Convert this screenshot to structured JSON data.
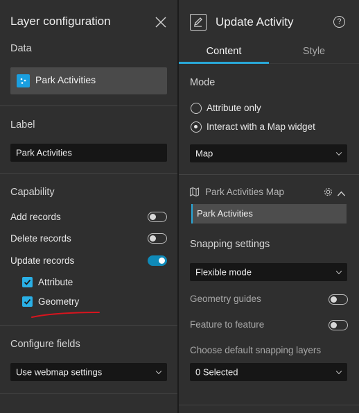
{
  "left_panel": {
    "title": "Layer configuration",
    "data_section": {
      "heading": "Data",
      "layer_name": "Park Activities"
    },
    "label_section": {
      "heading": "Label",
      "value": "Park Activities"
    },
    "capability_section": {
      "heading": "Capability",
      "add_records": {
        "label": "Add records",
        "on": false
      },
      "delete_records": {
        "label": "Delete records",
        "on": false
      },
      "update_records": {
        "label": "Update records",
        "on": true
      },
      "attribute": {
        "label": "Attribute",
        "checked": true
      },
      "geometry": {
        "label": "Geometry",
        "checked": true
      }
    },
    "configure_fields": {
      "heading": "Configure fields",
      "value": "Use webmap settings"
    }
  },
  "right_panel": {
    "title": "Update Activity",
    "tabs": [
      {
        "label": "Content",
        "active": true
      },
      {
        "label": "Style",
        "active": false
      }
    ],
    "mode": {
      "heading": "Mode",
      "options": [
        {
          "label": "Attribute only",
          "selected": false
        },
        {
          "label": "Interact with a Map widget",
          "selected": true
        }
      ],
      "map_select": "Map"
    },
    "map_section": {
      "title": "Park Activities Map",
      "layer": "Park Activities"
    },
    "snapping": {
      "heading": "Snapping settings",
      "mode_value": "Flexible mode",
      "geometry_guides": {
        "label": "Geometry guides",
        "on": false
      },
      "feature_to_feature": {
        "label": "Feature to feature",
        "on": false
      },
      "default_layers_label": "Choose default snapping layers",
      "default_layers_value": "0 Selected"
    }
  },
  "colors": {
    "accent": "#29a8d8",
    "annotation": "#d9141e",
    "panel_bg": "#2f2f2f",
    "field_bg": "#161616"
  }
}
